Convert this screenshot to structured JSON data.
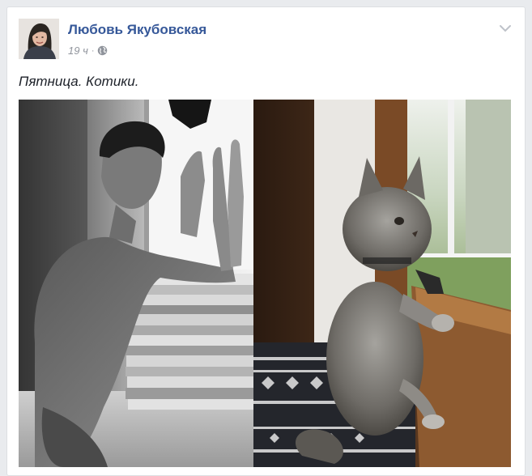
{
  "post": {
    "author": "Любовь Якубовская",
    "time": "19 ч",
    "separator": "·",
    "privacy_icon": "globe-icon",
    "menu_icon": "chevron-down-icon",
    "text": "Пятница. Котики."
  },
  "colors": {
    "link": "#365899",
    "meta": "#90949c",
    "text": "#1d2129",
    "background": "#e9ebee"
  }
}
